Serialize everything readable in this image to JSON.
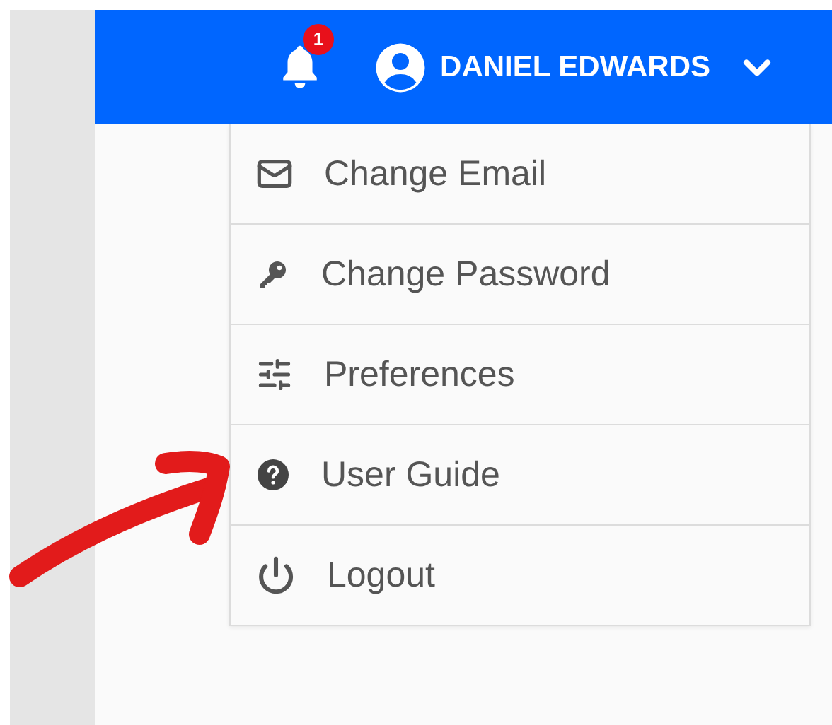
{
  "header": {
    "notification_count": "1",
    "user_name": "DANIEL EDWARDS",
    "expanded": true
  },
  "user_menu": {
    "items": [
      {
        "label": "Change Email"
      },
      {
        "label": "Change Password"
      },
      {
        "label": "Preferences"
      },
      {
        "label": "User Guide"
      },
      {
        "label": "Logout"
      }
    ]
  }
}
